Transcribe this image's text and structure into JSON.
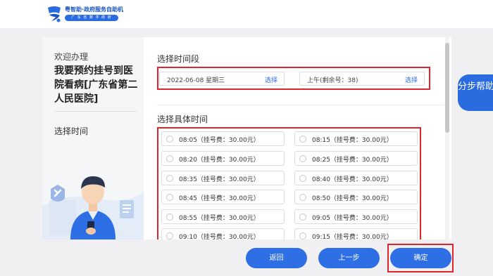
{
  "header": {
    "app_name": "粤智助·政府服务自助机",
    "tagline": "广 东 省 数 字 政 府"
  },
  "sidebar": {
    "welcome": "欢迎办理",
    "title": "我要预约挂号到医院看病[广东省第二人民医院]",
    "current_step": "选择时间"
  },
  "time_section": {
    "label": "选择时间段",
    "date_value": "2022-06-08 星期三",
    "date_select": "选择",
    "period_value": "上午(剩余号：38)",
    "period_select": "选择"
  },
  "slot_section": {
    "label": "选择具体时间",
    "slots": [
      "08:05（挂号费：30.00元）",
      "08:15（挂号费：30.00元）",
      "08:20（挂号费：30.00元）",
      "08:25（挂号费：30.00元）",
      "08:35（挂号费：30.00元）",
      "08:40（挂号费：30.00元）",
      "08:45（挂号费：30.00元）",
      "08:50（挂号费：30.00元）",
      "08:55（挂号费：30.00元）",
      "09:05（挂号费：30.00元）",
      "09:10（挂号费：30.00元）",
      "09:15（挂号费：30.00元）"
    ]
  },
  "help": {
    "label": "分步帮助"
  },
  "footer": {
    "back_label": "返回",
    "prev_label": "上一步",
    "confirm_label": "确定"
  },
  "colors": {
    "primary": "#2e6fe6",
    "highlight": "#e0262c",
    "background": "#f0f0f2"
  }
}
